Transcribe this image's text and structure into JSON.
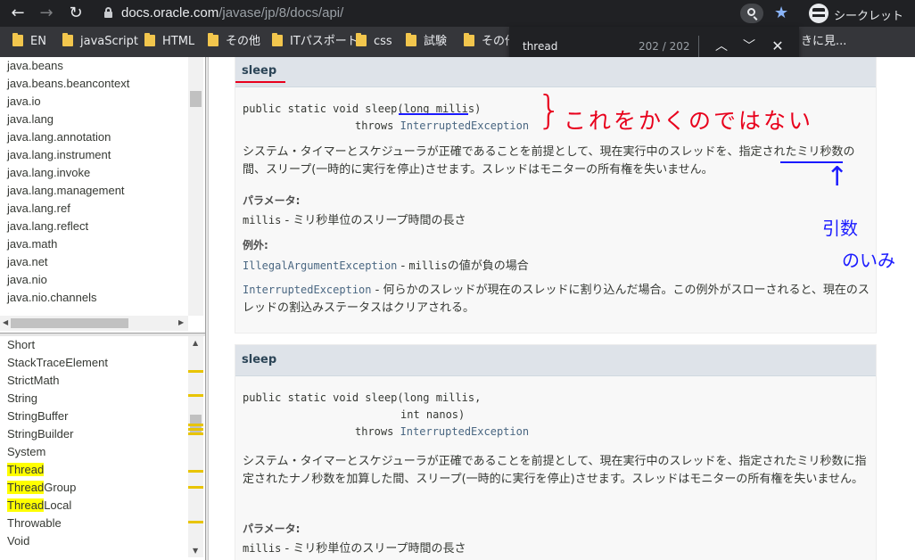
{
  "browser": {
    "url_domain": "docs.oracle.com",
    "url_path": "/javase/jp/8/docs/api/",
    "profile_label": "シークレット",
    "bookmarks": [
      "EN",
      "javaScript",
      "HTML",
      "その他",
      "ITパスポート",
      "css",
      "試験",
      "その他"
    ],
    "bookmark_overflow": "きに見...",
    "find": {
      "query": "thread",
      "count": "202 / 202"
    }
  },
  "package_list": [
    "java.beans",
    "java.beans.beancontext",
    "java.io",
    "java.lang",
    "java.lang.annotation",
    "java.lang.instrument",
    "java.lang.invoke",
    "java.lang.management",
    "java.lang.ref",
    "java.lang.reflect",
    "java.math",
    "java.net",
    "java.nio",
    "java.nio.channels"
  ],
  "class_list": {
    "items": [
      "Short",
      "StackTraceElement",
      "StrictMath",
      "String",
      "StringBuffer",
      "StringBuilder",
      "System"
    ],
    "thread_items": [
      {
        "hl": "Thread",
        "rest": ""
      },
      {
        "hl": "Thread",
        "rest": "Group"
      },
      {
        "hl": "Thread",
        "rest": "Local"
      }
    ],
    "tail_items": [
      "Throwable",
      "Void"
    ]
  },
  "method1": {
    "name": "sleep",
    "sig_prefix": "public static void sleep(",
    "sig_param": "long millis",
    "sig_suffix": ")",
    "throws_kw": "throws ",
    "throws_type": "InterruptedException",
    "desc_a": "システム・タイマーとスケジューラが正確であることを前提として、現在実行中のスレッドを、",
    "desc_b": "指定された",
    "desc_c": "ミリ秒数の間、スリープ(一時的に実行を停止)させます。スレッドはモニターの所有権を失いません。",
    "params_label": "パラメータ:",
    "param_name": "millis",
    "param_desc": " - ミリ秒単位のスリープ時間の長さ",
    "throws_label": "例外:",
    "ex1_name": "IllegalArgumentException",
    "ex1_desc_a": " - ",
    "ex1_code": "millis",
    "ex1_desc_b": "の値が負の場合",
    "ex2_name": "InterruptedException",
    "ex2_desc": " - 何らかのスレッドが現在のスレッドに割り込んだ場合。この例外がスローされると、現在のスレッドの割込みステータスはクリアされる。"
  },
  "method2": {
    "name": "sleep",
    "sig_line1": "public static void sleep(long millis,",
    "sig_line2": "int nanos)",
    "throws_kw": "throws ",
    "throws_type": "InterruptedException",
    "desc": "システム・タイマーとスケジューラが正確であることを前提として、現在実行中のスレッドを、指定されたミリ秒数に指定されたナノ秒数を加算した間、スリープ(一時的に実行を停止)させます。スレッドはモニターの所有権を失いません。",
    "params_label": "パラメータ:",
    "param_name": "millis",
    "param_desc": " - ミリ秒単位のスリープ時間の長さ"
  },
  "annotations": {
    "red_note": "これをかくのではない",
    "blue_note_line1": "引数",
    "blue_note_line2": "のいみ",
    "red_color": "#e8001c",
    "blue_color": "#1a1aff"
  }
}
